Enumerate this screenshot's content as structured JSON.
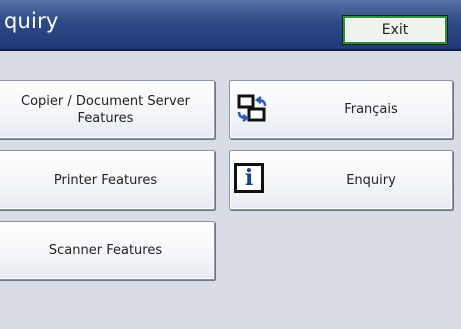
{
  "header": {
    "title": "quiry",
    "exit_label": "Exit"
  },
  "menu": {
    "copier_line1": "Copier / Document Server",
    "copier_line2": "Features",
    "printer": "Printer Features",
    "scanner": "Scanner Features",
    "language": "Français",
    "enquiry": "Enquiry"
  },
  "icons": {
    "language": "language-switch-icon",
    "enquiry": "info-icon"
  },
  "colors": {
    "title_bar": "#2d4a86",
    "exit_border": "#2f8f3b",
    "info_icon": "#1c3f8f",
    "background": "#d8dde5"
  }
}
